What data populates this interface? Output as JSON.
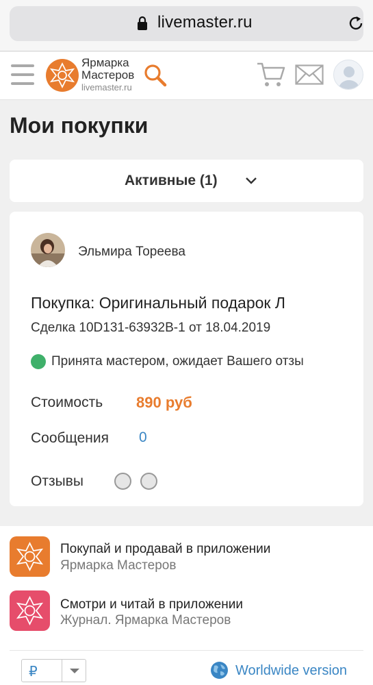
{
  "browser": {
    "url": "livemaster.ru"
  },
  "header": {
    "logo_line1": "Ярмарка",
    "logo_line2": "Мастеров",
    "logo_url": "livemaster.ru"
  },
  "page": {
    "title": "Мои покупки",
    "filter_label": "Активные (1)"
  },
  "order": {
    "seller_name": "Эльмира Тореева",
    "title": "Покупка: Оригинальный подарок Л",
    "deal": "Сделка 10D131-63932B-1 от 18.04.2019",
    "status": "Принята мастером, ожидает Вашего отзы",
    "status_color": "#3fb06a",
    "cost_label": "Стоимость",
    "cost_value": "890 руб",
    "messages_label": "Сообщения",
    "messages_value": "0",
    "reviews_label": "Отзывы"
  },
  "apps": [
    {
      "title": "Покупай и продавай в приложении",
      "subtitle": "Ярмарка Мастеров",
      "color": "#e87c2e"
    },
    {
      "title": "Смотри и читай в приложении",
      "subtitle": "Журнал. Ярмарка Мастеров",
      "color": "#e64d6b"
    }
  ],
  "footer": {
    "currency_symbol": "₽",
    "worldwide_label": "Worldwide version"
  },
  "colors": {
    "accent": "#e87c2e",
    "link": "#3a86c4"
  }
}
